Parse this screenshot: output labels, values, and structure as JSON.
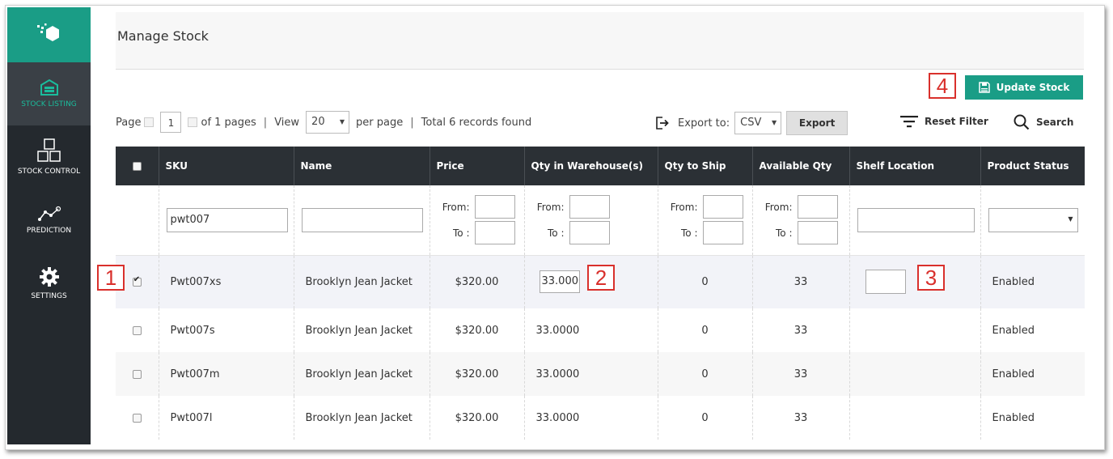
{
  "sidebar": {
    "logo": "logo",
    "items": [
      {
        "label": "STOCK LISTING",
        "icon": "warehouse-icon",
        "active": true
      },
      {
        "label": "STOCK CONTROL",
        "icon": "boxes-icon",
        "active": false
      },
      {
        "label": "PREDICTION",
        "icon": "trend-icon",
        "active": false
      },
      {
        "label": "SETTINGS",
        "icon": "gear-icon",
        "active": false
      }
    ]
  },
  "header": {
    "title": "Manage Stock"
  },
  "toolbar": {
    "update_label": "Update Stock"
  },
  "markers": {
    "m1": "1",
    "m2": "2",
    "m3": "3",
    "m4": "4"
  },
  "pager": {
    "page_label": "Page",
    "page_value": "1",
    "of_pages": "of 1 pages",
    "separator": "|",
    "view_label": "View",
    "view_value": "20",
    "per_page": "per page",
    "total": "Total 6 records found"
  },
  "export": {
    "label": "Export to:",
    "format": "CSV",
    "button": "Export"
  },
  "filters": {
    "reset_label": "Reset Filter",
    "search_label": "Search"
  },
  "table": {
    "columns": [
      "SKU",
      "Name",
      "Price",
      "Qty in Warehouse(s)",
      "Qty to Ship",
      "Available Qty",
      "Shelf Location",
      "Product Status"
    ],
    "filter_row": {
      "sku_value": "pwt007",
      "name_value": "",
      "from_label": "From:",
      "to_label": "To :"
    },
    "rows": [
      {
        "checked": true,
        "sku": "Pwt007xs",
        "name": "Brooklyn Jean Jacket",
        "price": "$320.00",
        "qty_warehouse": "33.0000",
        "qty_ship": "0",
        "available": "33",
        "shelf": "",
        "status": "Enabled",
        "editable": true
      },
      {
        "checked": false,
        "sku": "Pwt007s",
        "name": "Brooklyn Jean Jacket",
        "price": "$320.00",
        "qty_warehouse": "33.0000",
        "qty_ship": "0",
        "available": "33",
        "shelf": "",
        "status": "Enabled",
        "editable": false
      },
      {
        "checked": false,
        "sku": "Pwt007m",
        "name": "Brooklyn Jean Jacket",
        "price": "$320.00",
        "qty_warehouse": "33.0000",
        "qty_ship": "0",
        "available": "33",
        "shelf": "",
        "status": "Enabled",
        "editable": false
      },
      {
        "checked": false,
        "sku": "Pwt007l",
        "name": "Brooklyn Jean Jacket",
        "price": "$320.00",
        "qty_warehouse": "33.0000",
        "qty_ship": "0",
        "available": "33",
        "shelf": "",
        "status": "Enabled",
        "editable": false
      }
    ]
  },
  "colors": {
    "accent": "#1a9d86",
    "sidebar_bg": "#24292e",
    "header_bg": "#2b3035",
    "marker": "#d9302c"
  }
}
